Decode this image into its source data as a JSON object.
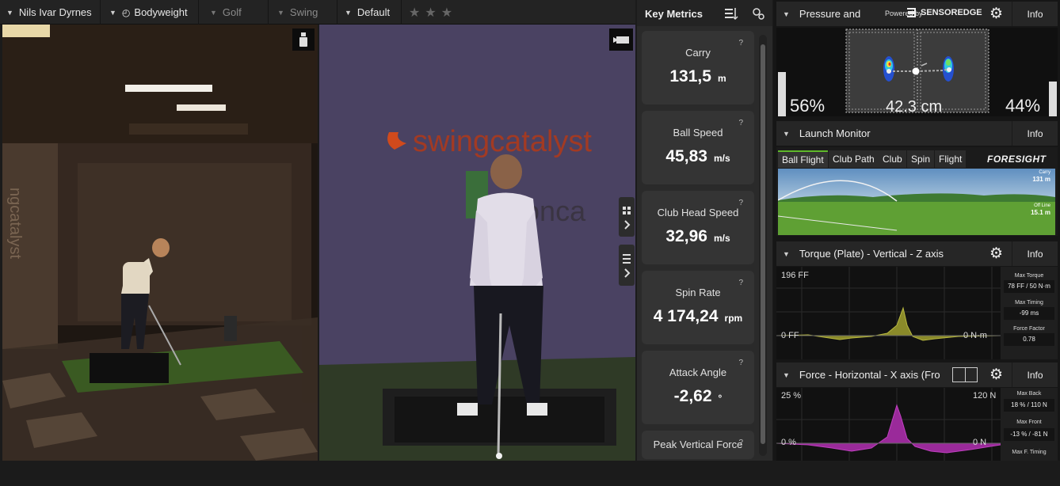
{
  "topbar": {
    "user": "Nils Ivar Dyrnes",
    "profile": "Bodyweight",
    "sport": "Golf",
    "category": "Swing",
    "layout": "Default",
    "rating_stars": 3
  },
  "metrics": {
    "title": "Key Metrics",
    "cards": [
      {
        "label": "Carry",
        "value": "131,5",
        "unit": "m",
        "q": "?"
      },
      {
        "label": "Ball Speed",
        "value": "45,83",
        "unit": "m/s",
        "q": "?"
      },
      {
        "label": "Club Head Speed",
        "value": "32,96",
        "unit": "m/s",
        "q": "?"
      },
      {
        "label": "Spin Rate",
        "value": "4 174,24",
        "unit": "rpm",
        "q": "?"
      },
      {
        "label": "Attack Angle",
        "value": "-2,62",
        "unit": "°",
        "q": "?"
      },
      {
        "label": "Peak Vertical Force",
        "value": "",
        "unit": "",
        "q": "?"
      }
    ]
  },
  "pressure": {
    "title": "Pressure and",
    "powered_by": "Powered by",
    "brand": "SENSOREDGE",
    "info": "Info",
    "left_pct": "56%",
    "right_pct": "44%",
    "distance": "42.3 cm",
    "left_fraction": 0.56,
    "right_fraction": 0.44
  },
  "launch": {
    "title": "Launch Monitor",
    "info": "Info",
    "tabs": [
      "Ball Flight",
      "Club Path",
      "Club",
      "Spin",
      "Flight"
    ],
    "brand": "FORESIGHT",
    "carry_label": "Carry",
    "carry_value": "131 m",
    "offline_label": "Off Line",
    "offline_value": "15.1 m"
  },
  "torque": {
    "title": "Torque (Plate) - Vertical - Z axis",
    "info": "Info",
    "y_top": "196 FF",
    "y_zero": "0 FF",
    "right_zero": "0 N·m",
    "stats": [
      {
        "label": "Max Torque",
        "value": "78 FF / 50 N·m"
      },
      {
        "label": "Max Timing",
        "value": "-99 ms"
      },
      {
        "label": "Force Factor",
        "value": "0.78"
      }
    ]
  },
  "force": {
    "title": "Force - Horizontal - X axis (Front/l",
    "info": "Info",
    "y_top": "25 %",
    "y_zero": "0 %",
    "right_top": "120 N",
    "right_zero": "0 N",
    "stats": [
      {
        "label": "Max Back",
        "value": "18 % / 110 N"
      },
      {
        "label": "Max Front",
        "value": "-13 % / -81 N"
      },
      {
        "label": "Max F. Timing",
        "value": ""
      }
    ]
  },
  "colors": {
    "accent_green": "#5fb82a",
    "torque_fill": "#8a8a2a",
    "force_fill": "#9a2a9a"
  }
}
